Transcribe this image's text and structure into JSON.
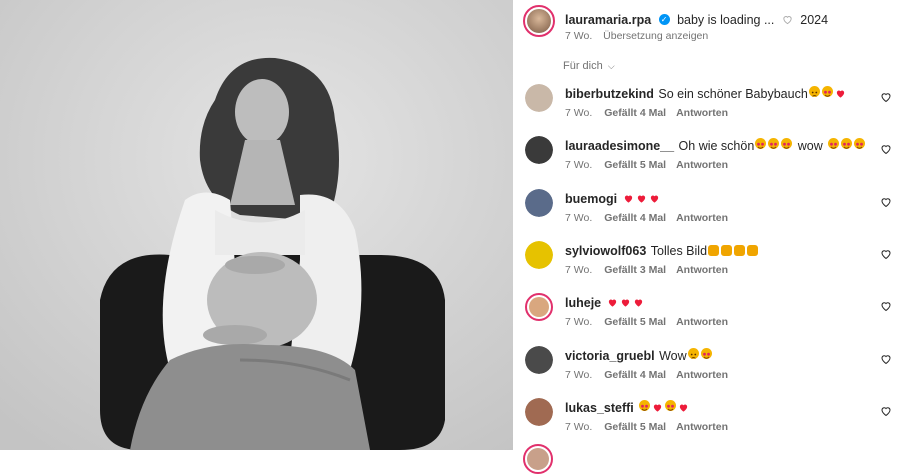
{
  "post": {
    "author": "lauramaria.rpa",
    "caption": "baby is loading ...",
    "caption_year": "2024",
    "time": "7 Wo.",
    "translate": "Übersetzung anzeigen"
  },
  "filter": {
    "label": "Für dich"
  },
  "comments": [
    {
      "user": "biberbutzekind",
      "text": "So ein schöner Babybauch",
      "emojis": [
        "sad-face",
        "heart-eyes",
        "heart"
      ],
      "time": "7 Wo.",
      "likes": "Gefällt 4 Mal",
      "reply": "Antworten"
    },
    {
      "user": "lauraadesimone__",
      "text": "Oh wie schön",
      "emojis": [
        "heart-eyes",
        "heart-eyes",
        "heart-eyes"
      ],
      "text2": "wow",
      "emojis2": [
        "heart-eyes",
        "heart-eyes",
        "heart-eyes"
      ],
      "time": "7 Wo.",
      "likes": "Gefällt 5 Mal",
      "reply": "Antworten"
    },
    {
      "user": "buemogi",
      "text": "",
      "emojis": [
        "heart",
        "heart",
        "heart"
      ],
      "time": "7 Wo.",
      "likes": "Gefällt 4 Mal",
      "reply": "Antworten"
    },
    {
      "user": "sylviowolf063",
      "text": "Tolles Bild",
      "emojis": [
        "clap",
        "clap",
        "clap",
        "clap"
      ],
      "time": "7 Wo.",
      "likes": "Gefällt 3 Mal",
      "reply": "Antworten"
    },
    {
      "user": "luheje",
      "text": "",
      "emojis": [
        "heart",
        "heart",
        "heart"
      ],
      "time": "7 Wo.",
      "likes": "Gefällt 5 Mal",
      "reply": "Antworten"
    },
    {
      "user": "victoria_gruebl",
      "text": "Wow",
      "emojis": [
        "sad-face",
        "heart-eyes"
      ],
      "time": "7 Wo.",
      "likes": "Gefällt 4 Mal",
      "reply": "Antworten"
    },
    {
      "user": "lukas_steffi",
      "text": "",
      "emojis": [
        "heart-eyes",
        "heart",
        "heart-eyes",
        "heart"
      ],
      "time": "7 Wo.",
      "likes": "Gefällt 5 Mal",
      "reply": "Antworten"
    }
  ],
  "colors": {
    "accent": "#0095f6",
    "heart": "#ed1c3a",
    "muted": "#737373",
    "ring": "#e1306c"
  }
}
